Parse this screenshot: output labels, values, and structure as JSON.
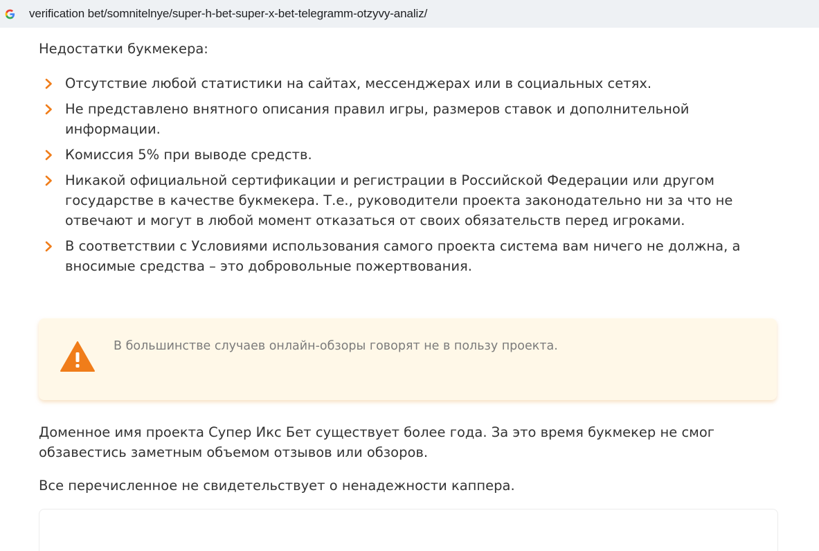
{
  "browser": {
    "url": "verification bet/somnitelnye/super-h-bet-super-x-bet-telegramm-otzyvy-analiz/",
    "icon": "google-g-icon"
  },
  "article": {
    "cons_heading": "Недостатки букмекера:",
    "cons": [
      "Отсутствие любой статистики на сайтах, мессенджерах или в социальных сетях.",
      "Не представлено внятного описания правил игры, размеров ставок и дополнительной информации.",
      "Комиссия 5% при выводе средств.",
      "Никакой официальной сертификации и регистрации в Российской Федерации или другом государстве в качестве букмекера. Т.е., руководители проекта законодательно ни за что не отвечают и могут в любой момент отказаться от своих обязательств перед игроками.",
      "В соответствии с Условиями использования самого проекта система вам ничего не должна, а вносимые средства – это добровольные пожертвования."
    ],
    "warning": {
      "icon": "warning-triangle-icon",
      "text": "В большинстве случаев онлайн-обзоры говорят не в пользу проекта."
    },
    "paragraphs": [
      "Доменное имя проекта Супер Икс Бет существует более года. За это время букмекер не смог обзавестись заметным объемом отзывов или обзоров.",
      "Все перечисленное не свидетельствует о ненадежности каппера."
    ]
  },
  "colors": {
    "accent": "#f07d1a",
    "warning_bg": "#fff8e8",
    "url_bar_bg": "#eef1f4"
  }
}
